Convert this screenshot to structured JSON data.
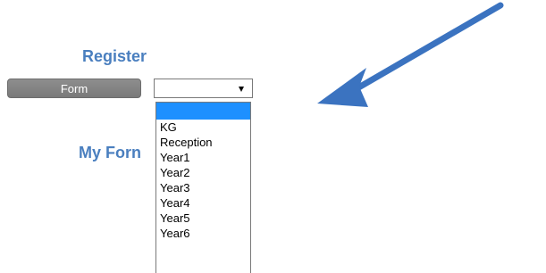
{
  "register": {
    "title": "Register"
  },
  "form": {
    "label": "Form",
    "select": {
      "value": "",
      "options": [
        "",
        "KG",
        "Reception",
        "Year1",
        "Year2",
        "Year3",
        "Year4",
        "Year5",
        "Year6"
      ]
    }
  },
  "my_form": {
    "title": "My Forn"
  },
  "colors": {
    "heading": "#4a7fbf",
    "label_bg": "#808080",
    "highlight": "#1e90ff",
    "arrow": "#3b73c0"
  },
  "icons": {
    "arrow": "arrow-icon",
    "dropdown": "chevron-down-icon"
  }
}
